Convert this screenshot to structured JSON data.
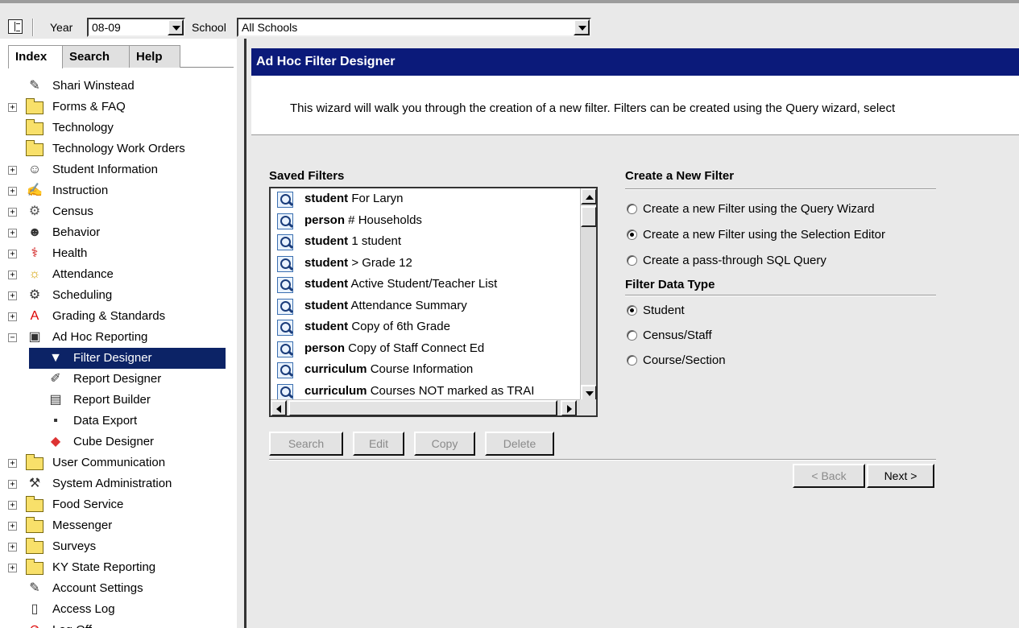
{
  "toolbar": {
    "year_label": "Year",
    "year_value": "08-09",
    "school_label": "School",
    "school_value": "All Schools"
  },
  "nav": {
    "tabs": [
      {
        "label": "Index"
      },
      {
        "label": "Search"
      },
      {
        "label": "Help"
      }
    ],
    "items": [
      {
        "label": "Shari Winstead",
        "icon": "user-edit-icon"
      },
      {
        "label": "Forms & FAQ",
        "icon": "folder-icon",
        "expander": "+"
      },
      {
        "label": "Technology",
        "icon": "folder-icon"
      },
      {
        "label": "Technology Work Orders",
        "icon": "folder-icon"
      },
      {
        "label": "Student Information",
        "icon": "student-icon",
        "expander": "+"
      },
      {
        "label": "Instruction",
        "icon": "instruction-icon",
        "expander": "+"
      },
      {
        "label": "Census",
        "icon": "census-icon",
        "expander": "+"
      },
      {
        "label": "Behavior",
        "icon": "behavior-icon",
        "expander": "+"
      },
      {
        "label": "Health",
        "icon": "health-icon",
        "expander": "+"
      },
      {
        "label": "Attendance",
        "icon": "attendance-icon",
        "expander": "+"
      },
      {
        "label": "Scheduling",
        "icon": "scheduling-icon",
        "expander": "+"
      },
      {
        "label": "Grading & Standards",
        "icon": "grading-icon",
        "expander": "+"
      },
      {
        "label": "Ad Hoc Reporting",
        "icon": "adhoc-reporting-icon",
        "expander": "−"
      },
      {
        "label": "Filter Designer",
        "icon": "filter-icon",
        "child": true,
        "selected": true
      },
      {
        "label": "Report Designer",
        "icon": "report-designer-icon",
        "child": true
      },
      {
        "label": "Report Builder",
        "icon": "report-builder-icon",
        "child": true
      },
      {
        "label": "Data Export",
        "icon": "floppy-disk-icon",
        "child": true
      },
      {
        "label": "Cube Designer",
        "icon": "cube-icon",
        "child": true
      },
      {
        "label": "User Communication",
        "icon": "folder-icon",
        "expander": "+"
      },
      {
        "label": "System Administration",
        "icon": "system-admin-icon",
        "expander": "+"
      },
      {
        "label": "Food Service",
        "icon": "folder-icon",
        "expander": "+"
      },
      {
        "label": "Messenger",
        "icon": "folder-icon",
        "expander": "+"
      },
      {
        "label": "Surveys",
        "icon": "folder-icon",
        "expander": "+"
      },
      {
        "label": "KY State Reporting",
        "icon": "folder-icon",
        "expander": "+"
      },
      {
        "label": "Account Settings",
        "icon": "account-settings-icon"
      },
      {
        "label": "Access Log",
        "icon": "document-icon"
      },
      {
        "label": "Log Off",
        "icon": "log-off-icon"
      }
    ]
  },
  "main": {
    "title": "Ad Hoc Filter Designer",
    "intro": "This wizard will walk you through the creation of a new filter. Filters can be created using the Query wizard, select",
    "saved_filters_title": "Saved Filters",
    "saved_filters": [
      {
        "type": "student",
        "name": " For Laryn"
      },
      {
        "type": "person",
        "name": " # Households"
      },
      {
        "type": "student",
        "name": " 1 student"
      },
      {
        "type": "student",
        "name": " > Grade 12"
      },
      {
        "type": "student",
        "name": " Active Student/Teacher List"
      },
      {
        "type": "student",
        "name": " Attendance Summary"
      },
      {
        "type": "student",
        "name": " Copy of 6th Grade"
      },
      {
        "type": "person",
        "name": " Copy of Staff Connect Ed"
      },
      {
        "type": "curriculum",
        "name": " Course Information"
      },
      {
        "type": "curriculum",
        "name": " Courses NOT marked as TRAI"
      }
    ],
    "buttons": {
      "search": "Search",
      "edit": "Edit",
      "copy": "Copy",
      "delete": "Delete",
      "back": "< Back",
      "next": "Next >"
    },
    "create_title": "Create a New Filter",
    "create_options": [
      {
        "label": "Create a new Filter using the Query Wizard",
        "checked": false
      },
      {
        "label": "Create a new Filter using the Selection Editor",
        "checked": true
      },
      {
        "label": "Create a pass-through SQL Query",
        "checked": false
      }
    ],
    "data_type_title": "Filter Data Type",
    "data_type_options": [
      {
        "label": "Student",
        "checked": true
      },
      {
        "label": "Census/Staff",
        "checked": false
      },
      {
        "label": "Course/Section",
        "checked": false
      }
    ]
  }
}
